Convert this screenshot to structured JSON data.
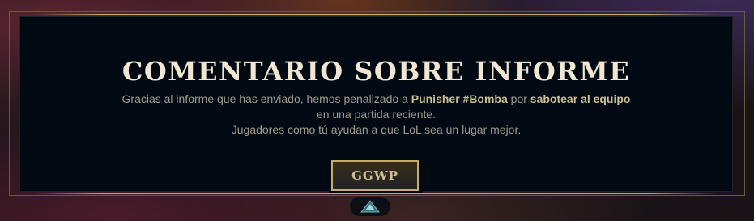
{
  "dialog": {
    "title": "COMENTARIO SOBRE INFORME",
    "message": {
      "line1_pre": "Gracias al informe que has enviado, hemos penalizado a ",
      "player": "Punisher #Bomba",
      "line1_mid": " por ",
      "offense": "sabotear al equipo",
      "line2": "en una partida reciente.",
      "line3": "Jugadores como tú ayudan a que LoL sea un lugar mejor."
    },
    "confirm_label": "GGWP"
  },
  "colors": {
    "accent_gold": "#c8aa6e",
    "title": "#f0e6d2",
    "body_text": "#a09b8c",
    "panel_bg": "#010a13"
  },
  "icons": {
    "expand": "chevron-up-icon"
  }
}
